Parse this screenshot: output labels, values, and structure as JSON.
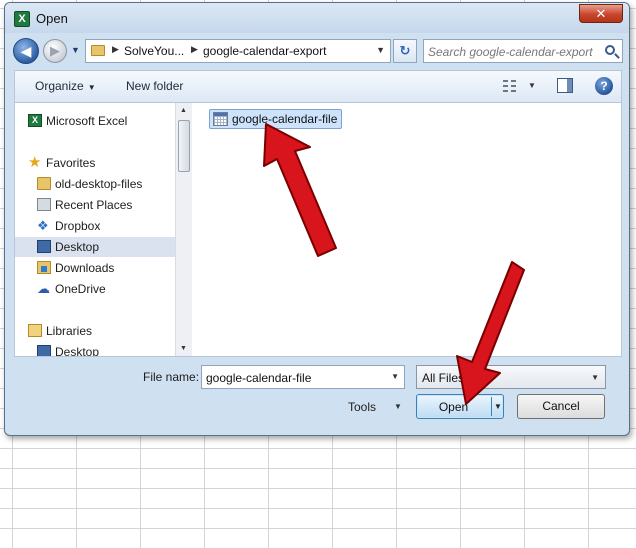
{
  "window": {
    "title": "Open",
    "app_icon_letter": "X",
    "close_glyph": "✕"
  },
  "navigation": {
    "back_glyph": "◀",
    "forward_glyph": "▶",
    "breadcrumb": [
      "SolveYou...",
      "google-calendar-export"
    ],
    "refresh_glyph": "↻",
    "search_placeholder": "Search google-calendar-export"
  },
  "toolbar": {
    "organize_label": "Organize",
    "new_folder_label": "New folder",
    "help_glyph": "?"
  },
  "nav_pane": {
    "items": [
      {
        "label": "Microsoft Excel",
        "icon": "excel-icon",
        "level": "top",
        "selected": false
      },
      {
        "label": "Favorites",
        "icon": "star-icon",
        "level": "top",
        "selected": false
      },
      {
        "label": "old-desktop-files",
        "icon": "folder-icon",
        "level": "child",
        "selected": false
      },
      {
        "label": "Recent Places",
        "icon": "recent-places-icon",
        "level": "child",
        "selected": false
      },
      {
        "label": "Dropbox",
        "icon": "dropbox-icon",
        "level": "child",
        "selected": false
      },
      {
        "label": "Desktop",
        "icon": "desktop-icon",
        "level": "child",
        "selected": true
      },
      {
        "label": "Downloads",
        "icon": "downloads-icon",
        "level": "child",
        "selected": false
      },
      {
        "label": "OneDrive",
        "icon": "onedrive-icon",
        "level": "child",
        "selected": false
      },
      {
        "label": "Libraries",
        "icon": "libraries-icon",
        "level": "top",
        "selected": false
      },
      {
        "label": "Desktop",
        "icon": "desktop-icon",
        "level": "child",
        "selected": false
      }
    ]
  },
  "files": [
    {
      "name": "google-calendar-file",
      "icon": "calendar-file-icon",
      "selected": true
    }
  ],
  "bottom": {
    "file_name_label": "File name:",
    "file_name_value": "google-calendar-file",
    "file_type_value": "All Files",
    "tools_label": "Tools",
    "open_label": "Open",
    "cancel_label": "Cancel"
  },
  "colors": {
    "dialog_frame": "#cfe0f1",
    "annotation_arrow": "#d8141c"
  }
}
